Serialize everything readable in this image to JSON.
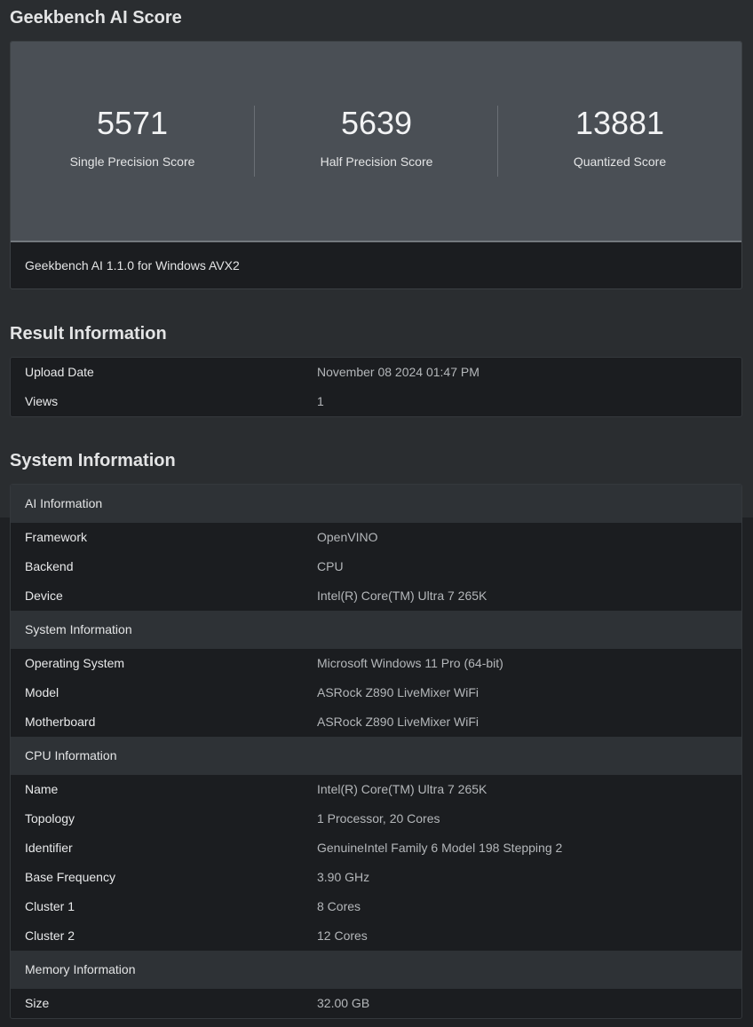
{
  "score_section": {
    "title": "Geekbench AI Score",
    "scores": [
      {
        "value": "5571",
        "label": "Single Precision Score"
      },
      {
        "value": "5639",
        "label": "Half Precision Score"
      },
      {
        "value": "13881",
        "label": "Quantized Score"
      }
    ],
    "version": "Geekbench AI 1.1.0 for Windows AVX2"
  },
  "result_section": {
    "title": "Result Information",
    "rows": [
      {
        "key": "Upload Date",
        "value": "November 08 2024 01:47 PM"
      },
      {
        "key": "Views",
        "value": "1"
      }
    ]
  },
  "system_section": {
    "title": "System Information",
    "groups": [
      {
        "header": "AI Information",
        "rows": [
          {
            "key": "Framework",
            "value": "OpenVINO"
          },
          {
            "key": "Backend",
            "value": "CPU"
          },
          {
            "key": "Device",
            "value": "Intel(R) Core(TM) Ultra 7 265K"
          }
        ]
      },
      {
        "header": "System Information",
        "rows": [
          {
            "key": "Operating System",
            "value": "Microsoft Windows 11 Pro (64-bit)"
          },
          {
            "key": "Model",
            "value": "ASRock Z890 LiveMixer WiFi"
          },
          {
            "key": "Motherboard",
            "value": "ASRock Z890 LiveMixer WiFi"
          }
        ]
      },
      {
        "header": "CPU Information",
        "rows": [
          {
            "key": "Name",
            "value": "Intel(R) Core(TM) Ultra 7 265K"
          },
          {
            "key": "Topology",
            "value": "1 Processor, 20 Cores"
          },
          {
            "key": "Identifier",
            "value": "GenuineIntel Family 6 Model 198 Stepping 2"
          },
          {
            "key": "Base Frequency",
            "value": "3.90 GHz"
          },
          {
            "key": "Cluster 1",
            "value": "8 Cores"
          },
          {
            "key": "Cluster 2",
            "value": "12 Cores"
          }
        ]
      },
      {
        "header": "Memory Information",
        "rows": [
          {
            "key": "Size",
            "value": "32.00 GB"
          }
        ]
      }
    ]
  }
}
